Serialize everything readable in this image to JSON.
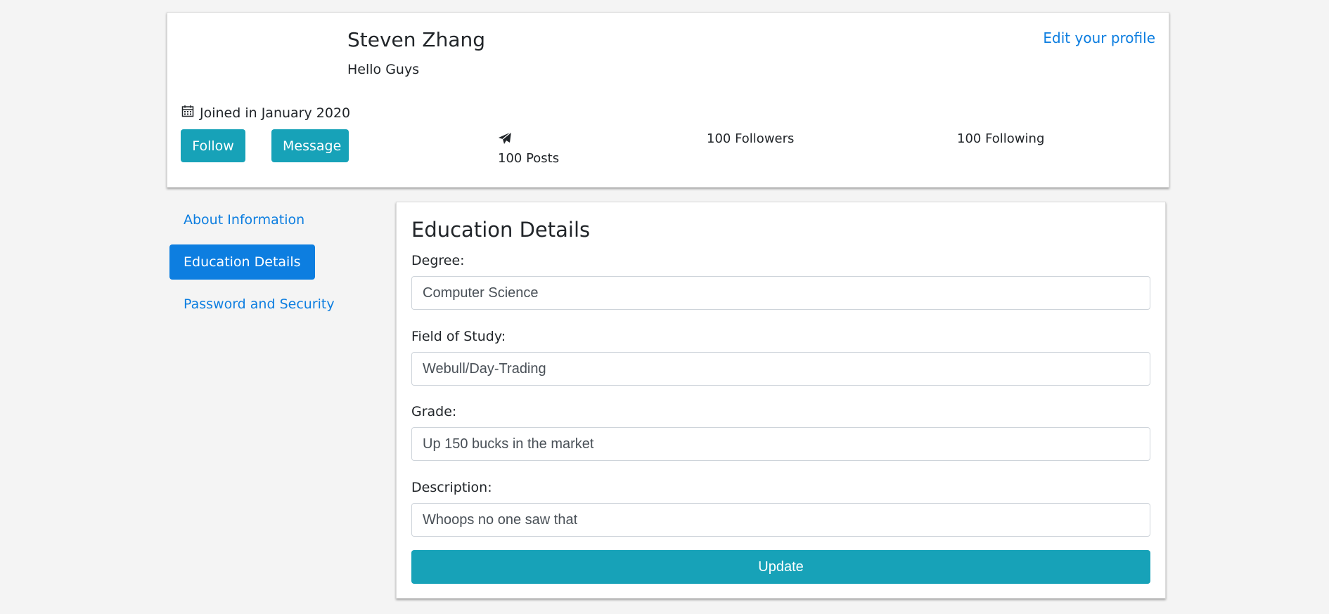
{
  "profile": {
    "name": "Steven Zhang",
    "bio": "Hello Guys",
    "edit_link": "Edit your profile",
    "joined": "Joined in January 2020",
    "follow_label": "Follow",
    "message_label": "Message",
    "posts": "100 Posts",
    "followers": "100 Followers",
    "following": "100 Following",
    "icons": {
      "joined": "calendar-icon",
      "posts": "paper-plane-icon"
    }
  },
  "sidebar": {
    "items": [
      {
        "label": "About Information",
        "active": false
      },
      {
        "label": "Education Details",
        "active": true
      },
      {
        "label": "Password and Security",
        "active": false
      }
    ]
  },
  "education": {
    "title": "Education Details",
    "fields": [
      {
        "label": "Degree:",
        "value": "Computer Science"
      },
      {
        "label": "Field of Study:",
        "value": "Webull/Day-Trading"
      },
      {
        "label": "Grade:",
        "value": "Up 150 bucks in the market"
      },
      {
        "label": "Description:",
        "value": "Whoops no one saw that"
      }
    ],
    "update_label": "Update"
  },
  "colors": {
    "accent": "#17a2b8",
    "link": "#0d7ee0",
    "background": "#f4f4f4"
  }
}
